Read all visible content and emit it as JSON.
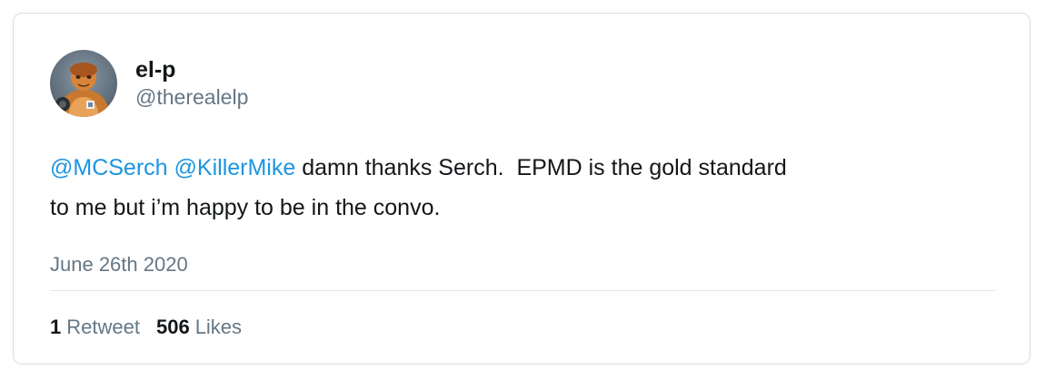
{
  "user": {
    "display_name": "el-p",
    "handle": "@therealelp"
  },
  "tweet": {
    "mention_1": "@MCSerch",
    "mention_2": "@KillerMike",
    "text_line_1": " damn thanks Serch.  EPMD is the gold standard",
    "text_line_2": "to me but i’m happy to be in the convo.",
    "date": "June 26th 2020"
  },
  "stats": {
    "retweets_count": "1",
    "retweets_label": "Retweet",
    "likes_count": "506",
    "likes_label": "Likes"
  },
  "colors": {
    "link": "#1b95e0",
    "text": "#14171a",
    "muted": "#657786",
    "border": "#d7dde2"
  },
  "icons": {
    "avatar": "user-avatar-image"
  }
}
